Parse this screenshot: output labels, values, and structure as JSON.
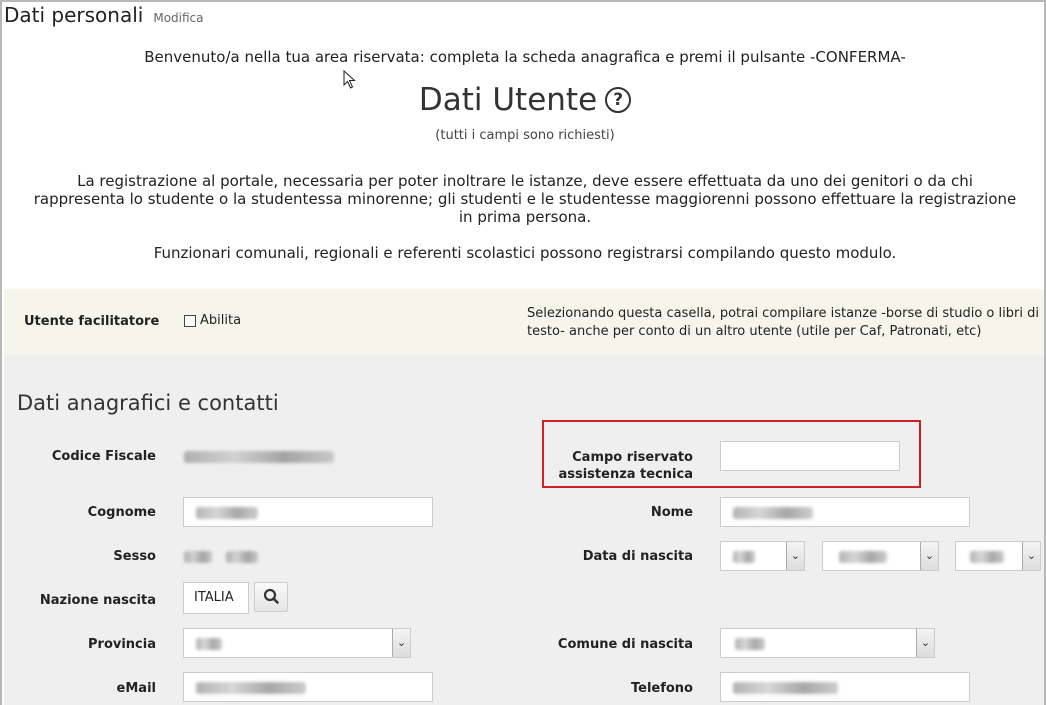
{
  "header": {
    "title": "Dati personali",
    "edit_link": "Modifica"
  },
  "intro": {
    "welcome": "Benvenuto/a nella tua area riservata: completa la scheda anagrafica e premi il pulsante -CONFERMA-",
    "heading": "Dati Utente",
    "help_glyph": "?",
    "required_note": "(tutti i campi sono richiesti)",
    "paragraph1": "La registrazione al portale, necessaria per poter inoltrare le istanze, deve essere effettuata da uno dei genitori o da chi rappresenta lo studente o la studentessa minorenne; gli studenti e le studentesse maggiorenni possono effettuare la registrazione in prima persona.",
    "paragraph2": "Funzionari comunali, regionali e referenti scolastici possono registrarsi compilando questo modulo."
  },
  "facilitator": {
    "label": "Utente facilitatore",
    "checkbox_label": "Abilita",
    "checked": false,
    "note": "Selezionando questa casella, potrai compilare istanze -borse di studio o libri di testo- anche per conto di un altro utente (utile per Caf, Patronati, etc)"
  },
  "form": {
    "section_title": "Dati anagrafici e contatti",
    "labels": {
      "codice_fiscale": "Codice Fiscale",
      "campo_riservato": "Campo riservato assistenza tecnica",
      "cognome": "Cognome",
      "nome": "Nome",
      "sesso": "Sesso",
      "data_nascita": "Data di nascita",
      "nazione_nascita": "Nazione nascita",
      "provincia": "Provincia",
      "comune_nascita": "Comune di nascita",
      "email": "eMail",
      "telefono": "Telefono"
    },
    "values": {
      "nazione_nascita": "ITALIA",
      "campo_riservato": ""
    },
    "icons": {
      "search": "search-icon",
      "dropdown": "chevron-down-icon"
    },
    "highlight_color": "#d0202a"
  }
}
